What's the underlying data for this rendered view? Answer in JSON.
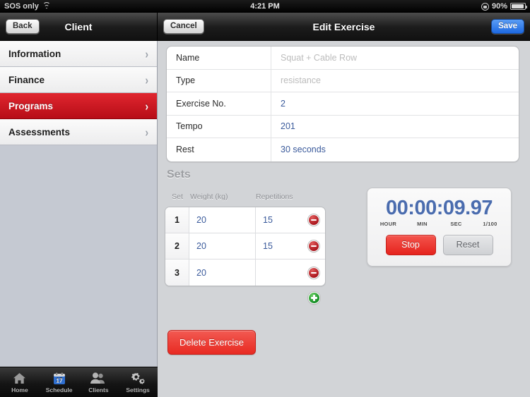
{
  "status_bar": {
    "carrier": "SOS only",
    "wifi_icon": "wifi-icon",
    "time": "4:21 PM",
    "rotation_lock_icon": "rotation-lock-icon",
    "battery_percent": "90%",
    "battery_icon": "battery-icon"
  },
  "left_nav": {
    "back_label": "Back",
    "title": "Client"
  },
  "right_nav": {
    "cancel_label": "Cancel",
    "title": "Edit Exercise",
    "save_label": "Save"
  },
  "sidebar": {
    "items": [
      {
        "label": "Information",
        "active": false
      },
      {
        "label": "Finance",
        "active": false
      },
      {
        "label": "Programs",
        "active": true
      },
      {
        "label": "Assessments",
        "active": false
      }
    ],
    "chevron": "›"
  },
  "form": {
    "rows": [
      {
        "label": "Name",
        "value": "Squat + Cable Row",
        "placeholder": true
      },
      {
        "label": "Type",
        "value": "resistance",
        "placeholder": true
      },
      {
        "label": "Exercise No.",
        "value": "2",
        "placeholder": false
      },
      {
        "label": "Tempo",
        "value": "201",
        "placeholder": false
      },
      {
        "label": "Rest",
        "value": "30 seconds",
        "placeholder": false
      }
    ]
  },
  "sets": {
    "title": "Sets",
    "headers": {
      "set": "Set",
      "weight": "Weight (kg)",
      "repetitions": "Repetitions"
    },
    "rows": [
      {
        "set": "1",
        "weight": "20",
        "reps": "15"
      },
      {
        "set": "2",
        "weight": "20",
        "reps": "15"
      },
      {
        "set": "3",
        "weight": "20",
        "reps": ""
      }
    ]
  },
  "timer": {
    "display": "00:00:09.97",
    "labels": {
      "hour": "HOUR",
      "min": "MIN",
      "sec": "SEC",
      "hundredth": "1/100"
    },
    "stop_label": "Stop",
    "reset_label": "Reset"
  },
  "actions": {
    "delete_exercise_label": "Delete Exercise"
  },
  "tabbar": {
    "tabs": [
      {
        "label": "Home",
        "icon": "home-icon"
      },
      {
        "label": "Schedule",
        "icon": "calendar-icon",
        "day": "17"
      },
      {
        "label": "Clients",
        "icon": "people-icon"
      },
      {
        "label": "Settings",
        "icon": "gears-icon"
      }
    ]
  },
  "colors": {
    "accent_red": "#cc1520",
    "link_blue": "#3a5a9b",
    "save_blue": "#1d68e0",
    "timer_blue": "#4a6cae",
    "sidebar_bg": "#c5c9d2",
    "main_bg": "#d2d4d7"
  }
}
